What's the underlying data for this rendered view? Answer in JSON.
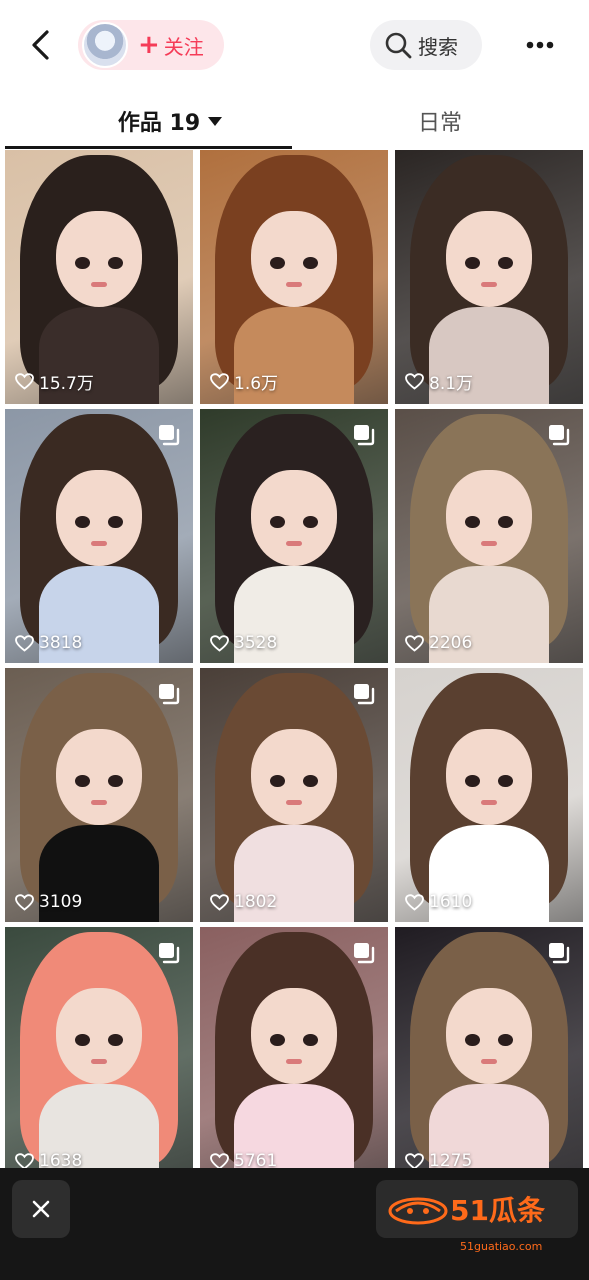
{
  "header": {
    "follow_label": "关注",
    "search_label": "搜索"
  },
  "tabs": [
    {
      "label": "作品 19",
      "active": true
    },
    {
      "label": "日常",
      "active": false
    }
  ],
  "grid": [
    {
      "likes": "15.7万",
      "multi": false
    },
    {
      "likes": "1.6万",
      "multi": false
    },
    {
      "likes": "8.1万",
      "multi": false
    },
    {
      "likes": "3818",
      "multi": true
    },
    {
      "likes": "3528",
      "multi": true
    },
    {
      "likes": "2206",
      "multi": true
    },
    {
      "likes": "3109",
      "multi": true
    },
    {
      "likes": "1802",
      "multi": true
    },
    {
      "likes": "1610",
      "multi": false
    },
    {
      "likes": "1638",
      "multi": true
    },
    {
      "likes": "5761",
      "multi": true
    },
    {
      "likes": "1275",
      "multi": true
    }
  ],
  "footer": {
    "brand_text": "51瓜条",
    "brand_url": "51guatiao.com"
  },
  "colors": {
    "accent": "#f53b57",
    "brand": "#ff6a1a"
  },
  "icons": [
    "back-arrow-icon",
    "search-icon",
    "more-dots-icon",
    "heart-icon",
    "multi-image-icon",
    "close-icon"
  ]
}
